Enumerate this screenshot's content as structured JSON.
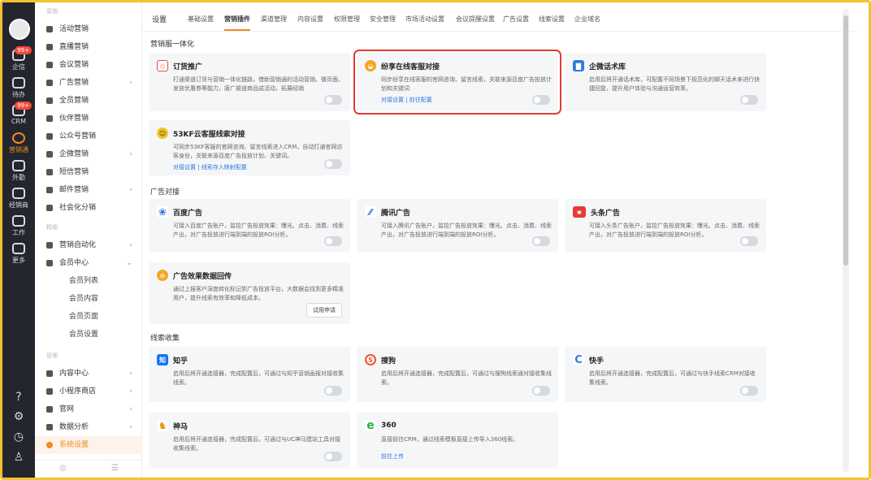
{
  "rail": {
    "items": [
      {
        "label": "企信",
        "badge": "99+"
      },
      {
        "label": "待办",
        "badge": ""
      },
      {
        "label": "CRM",
        "badge": "99+"
      },
      {
        "label": "营销通",
        "badge": ""
      },
      {
        "label": "外勤",
        "badge": ""
      },
      {
        "label": "经销商",
        "badge": ""
      },
      {
        "label": "工作",
        "badge": ""
      },
      {
        "label": "更多",
        "badge": ""
      }
    ]
  },
  "sidebar": {
    "group_top": "营销",
    "items": [
      {
        "label": "活动营销"
      },
      {
        "label": "直播营销"
      },
      {
        "label": "会议营销"
      },
      {
        "label": "广告营销"
      },
      {
        "label": "全员营销"
      },
      {
        "label": "伙伴营销"
      },
      {
        "label": "公众号营销"
      },
      {
        "label": "企微营销"
      },
      {
        "label": "短信营销"
      },
      {
        "label": "邮件营销"
      },
      {
        "label": "社会化分销"
      }
    ],
    "group_mid": "精细",
    "items2": [
      {
        "label": "营销自动化"
      },
      {
        "label": "会员中心"
      }
    ],
    "member_sub": [
      "会员列表",
      "会员内容",
      "会员页面",
      "会员设置"
    ],
    "group_manage": "管理",
    "items3": [
      {
        "label": "内容中心"
      },
      {
        "label": "小程序商店"
      },
      {
        "label": "官网"
      },
      {
        "label": "数据分析"
      },
      {
        "label": "系统设置"
      }
    ]
  },
  "tabs": {
    "title": "设置",
    "items": [
      "基础设置",
      "营销插件",
      "渠道管理",
      "内容设置",
      "权限管理",
      "安全管理",
      "市场活动设置",
      "会议提醒设置",
      "广告设置",
      "线索设置",
      "企业域名"
    ],
    "active_index": 1
  },
  "sections": [
    {
      "title": "营销服一体化",
      "cards": [
        {
          "title": "订货推广",
          "desc": "打通渠道订货与营销一体化链路，借助营销通的活动营销、微页面、发放优惠券等能力，唐广渠道商品成活动，拓展经销",
          "links": ""
        },
        {
          "title": "纷享在线客服对接",
          "desc": "同步纷享在线客服的官网咨询、留言线索，关联来源百度广告投放计划和关键词",
          "links": "对接设置 | 前往配置"
        },
        {
          "title": "企微话术库",
          "desc": "启用后将开通话术库，可配置不同场景下规范化的聊天话术来进行快捷回复，提升用户体验与沟通运营效率。",
          "links": ""
        },
        {
          "title": "53KF云客服线索对接",
          "desc": "可同步53KF客服的官网咨询、留言线索进入CRM，自动打通官网访客身份，关联来源百度广告投放计划、关键词。",
          "links": "对接设置 | 线索存入映射配置"
        }
      ]
    },
    {
      "title": "广告对接",
      "cards": [
        {
          "title": "百度广告",
          "desc": "可接入百度广告账户，监控广告投放效果：曝光、点击、消费、线索产出，对广告投放进行端到端的投放ROI分析。"
        },
        {
          "title": "腾讯广告",
          "desc": "可接入腾讯广告账户，监控广告投放效果：曝光、点击、消费、线索产出，对广告投放进行端到端的投放ROI分析。"
        },
        {
          "title": "头条广告",
          "desc": "可接入头条广告账户，监控广告投放效果：曝光、点击、消费、线索产出，对广告投放进行端到端的投放ROI分析。"
        },
        {
          "title": "广告效果数据回传",
          "desc": "通过上报客户深度转化标记到广告投放平台，大数据会找到更多精准用户，提升线索有效率和降低成本。",
          "button": "试用申请"
        }
      ]
    },
    {
      "title": "线索收集",
      "cards": [
        {
          "title": "知乎",
          "desc": "启用后将开通连接器，完成配置后，可通过与知乎营销画报对接收集线索。"
        },
        {
          "title": "搜狗",
          "desc": "启用后将开通连接器，完成配置后，可通过与搜狗线索通对接收集线索。"
        },
        {
          "title": "快手",
          "desc": "启用后将开通连接器，完成配置后，可通过与快手线索CRM对接收集线索。"
        },
        {
          "title": "神马",
          "desc": "启用后将开通连接器，完成配置后，可通过与UC神马建站工具对接收集线索。"
        },
        {
          "title": "360",
          "desc": "直接前往CRM，通过线索模板直接上传导入360线索。",
          "links": "前往上传"
        }
      ]
    }
  ],
  "colors": {
    "accent": "#f08b1d",
    "highlight": "#e23b32",
    "link": "#2f7bdc",
    "frame": "#f2c230"
  }
}
